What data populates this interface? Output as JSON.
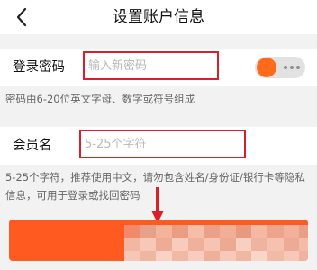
{
  "header": {
    "title": "设置账户信息",
    "back_icon": "chevron-left-icon"
  },
  "login_password": {
    "label": "登录密码",
    "placeholder": "输入新密码",
    "hint": "密码由6-20位英文字母、数字或符号组成",
    "visibility_toggle": {
      "on": true,
      "accent": "#ff6b1a"
    }
  },
  "member_name": {
    "label": "会员名",
    "placeholder": "5-25个字符",
    "hint": "5-25个字符，推荐使用中文，请勿包含姓名/身份证/银行卡等隐私信息，可用于登录或找回密码"
  },
  "submit_button": {
    "color": "#ff5a1f",
    "label_obscured": true
  },
  "annotation": {
    "box_color": "#d8202a",
    "arrow_color": "#d8202a"
  }
}
